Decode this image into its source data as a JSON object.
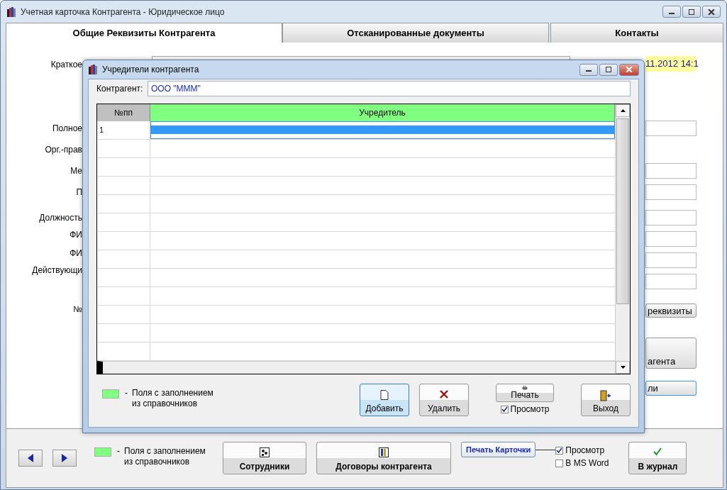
{
  "window": {
    "title": "Учетная карточка Контрагента - Юридическое лицо"
  },
  "tabs": [
    {
      "label": "Общие Реквизиты Контрагента",
      "selected": true
    },
    {
      "label": "Отсканированные документы",
      "selected": false
    },
    {
      "label": "Контакты",
      "selected": false
    }
  ],
  "form": {
    "labels": [
      "Краткое",
      "Полное",
      "Орг.-прав",
      "Ме",
      "П",
      "Должность",
      "ФИ",
      "ФИ",
      "Действующи",
      "№"
    ],
    "date_field": {
      "value": "11.2012 14:1"
    },
    "buttons": [
      "реквизиты",
      "агента",
      "ли"
    ]
  },
  "dialog": {
    "title": "Учредители контрагента",
    "counterparty": {
      "label": "Контрагент:",
      "value": "ООО \"МММ\""
    },
    "table": {
      "columns": [
        "№пп",
        "Учредитель"
      ],
      "rows": [
        {
          "number": "1",
          "selected": true
        }
      ]
    },
    "legend": {
      "dash": "-",
      "lines": [
        "Поля с заполнением",
        "из справочников"
      ]
    },
    "buttons": [
      {
        "kind": "add",
        "label": "Добавить",
        "focused": true
      },
      {
        "kind": "delete",
        "label": "Удалить",
        "focused": false
      },
      {
        "kind": "print",
        "label": "Печать",
        "focused": false
      },
      {
        "kind": "exit",
        "label": "Выход",
        "focused": false
      }
    ],
    "preview": {
      "label": "Просмотр",
      "checked": true
    }
  },
  "bottom_bar": {
    "legend": {
      "dash": "-",
      "lines": [
        "Поля с заполнением",
        "из справочников"
      ]
    },
    "buttons": [
      {
        "kind": "staff",
        "label": "Сотрудники"
      },
      {
        "kind": "contracts",
        "label": "Договоры контрагента"
      }
    ],
    "print_card": {
      "label": "Печать Карточки"
    },
    "options": [
      {
        "label": "Просмотр",
        "checked": true
      },
      {
        "label": "В MS Word",
        "checked": false
      }
    ],
    "journal": {
      "label": "В журнал"
    }
  }
}
